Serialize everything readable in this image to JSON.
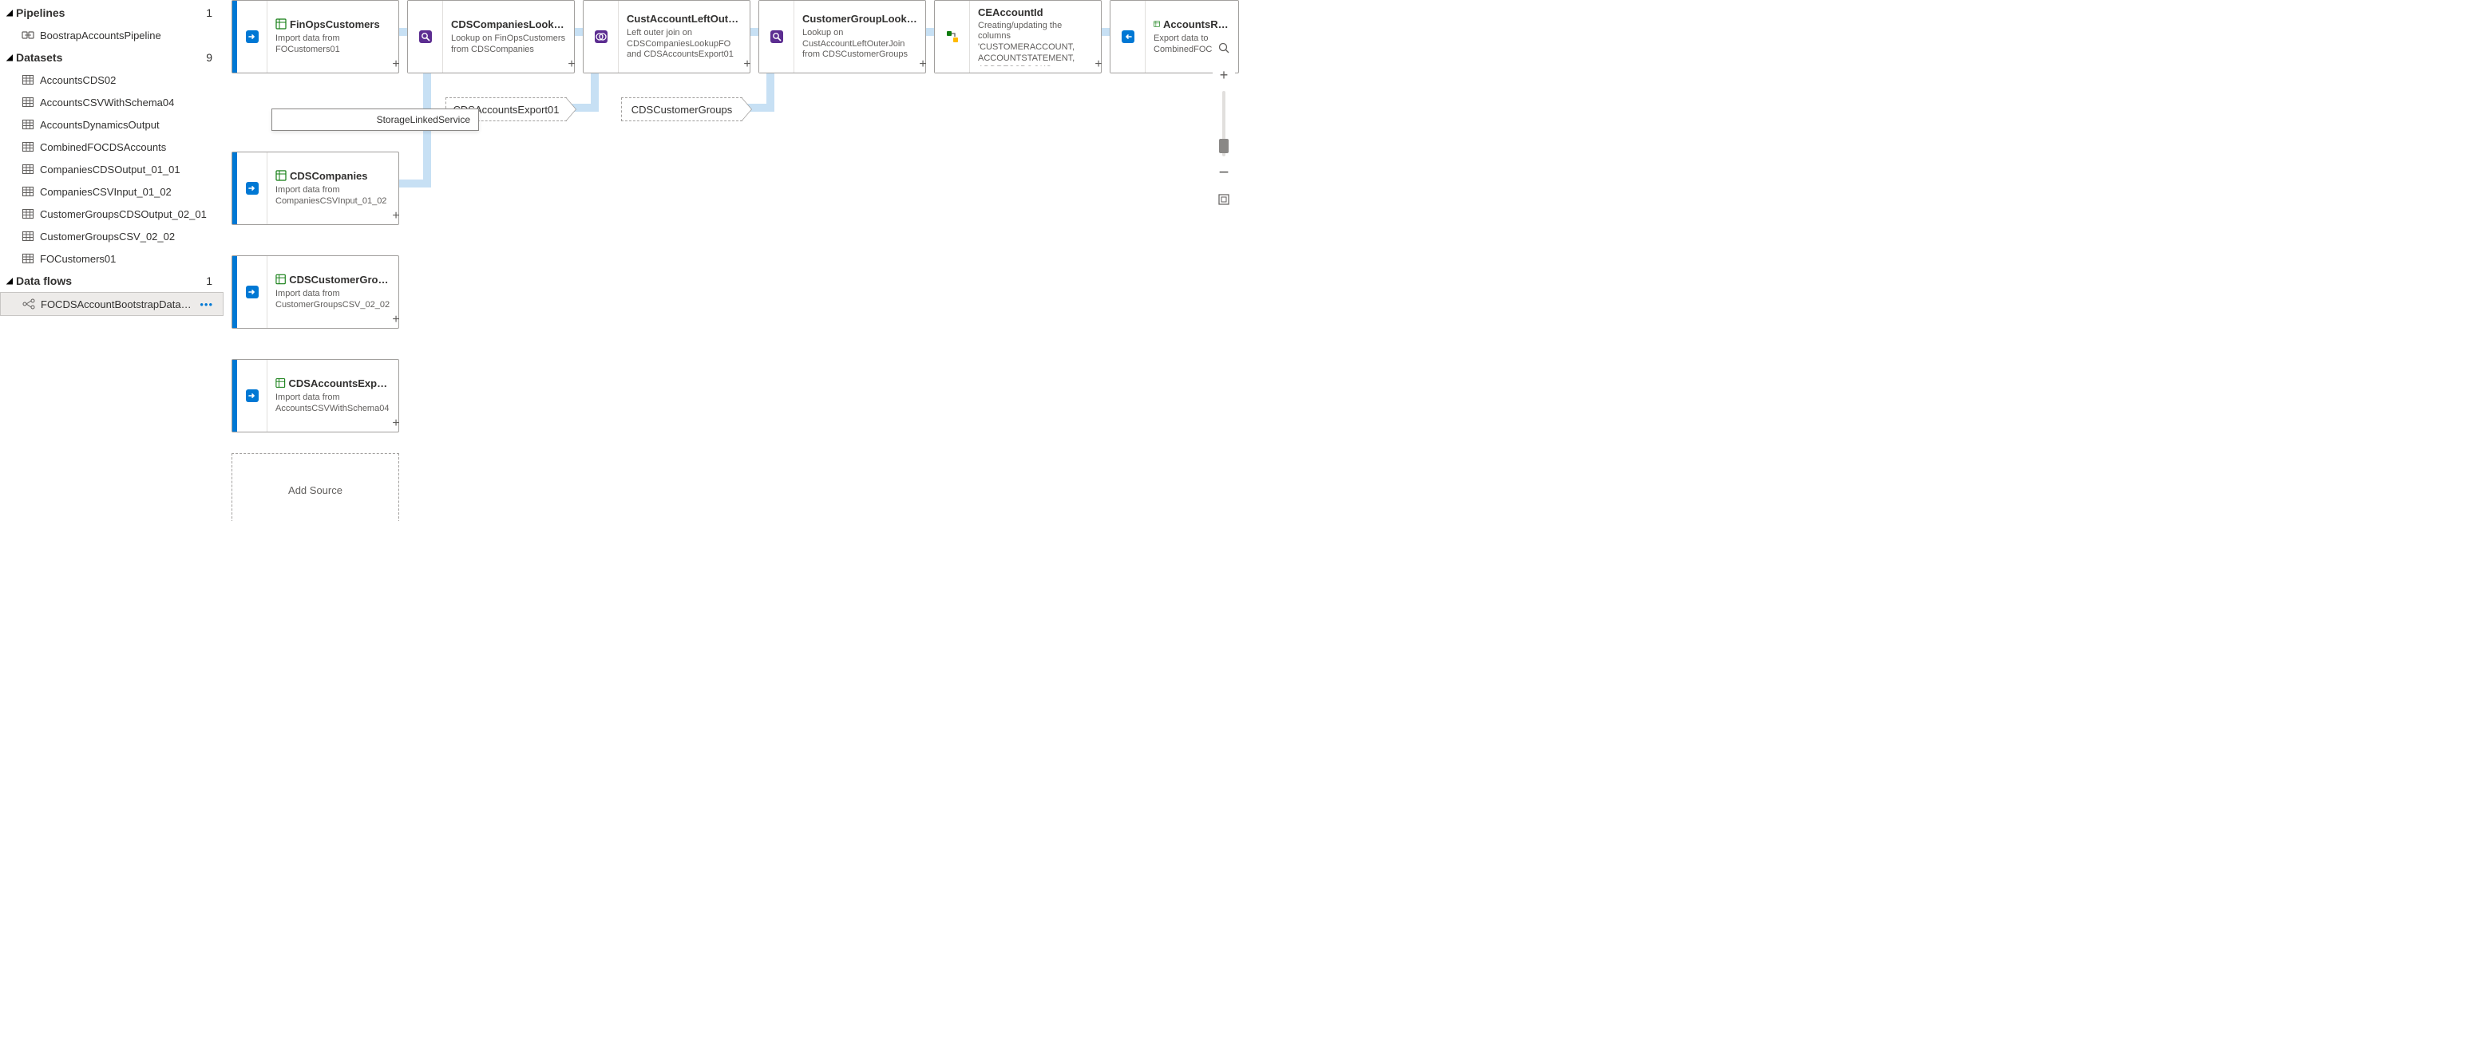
{
  "sidebar": {
    "sections": {
      "pipelines": {
        "label": "Pipelines",
        "count": "1"
      },
      "datasets": {
        "label": "Datasets",
        "count": "9"
      },
      "dataflows": {
        "label": "Data flows",
        "count": "1"
      }
    },
    "pipelines_items": [
      {
        "label": "BoostrapAccountsPipeline"
      }
    ],
    "datasets_items": [
      {
        "label": "AccountsCDS02"
      },
      {
        "label": "AccountsCSVWithSchema04"
      },
      {
        "label": "AccountsDynamicsOutput"
      },
      {
        "label": "CombinedFOCDSAccounts"
      },
      {
        "label": "CompaniesCDSOutput_01_01"
      },
      {
        "label": "CompaniesCSVInput_01_02"
      },
      {
        "label": "CustomerGroupsCDSOutput_02_01"
      },
      {
        "label": "CustomerGroupsCSV_02_02"
      },
      {
        "label": "FOCustomers01"
      }
    ],
    "dataflows_items": [
      {
        "label": "FOCDSAccountBootstrapDataF…"
      }
    ]
  },
  "canvas": {
    "tooltip": "StorageLinkedService",
    "add_source": "Add Source",
    "nodes": {
      "finops": {
        "title": "FinOpsCustomers",
        "desc": "Import data from FOCustomers01"
      },
      "cdscomp": {
        "title": "CDSCompanies",
        "desc": "Import data from CompaniesCSVInput_01_02"
      },
      "cdscg": {
        "title": "CDSCustomerGroups",
        "desc": "Import data from CustomerGroupsCSV_02_02"
      },
      "cdsacct": {
        "title": "CDSAccountsExport01",
        "desc": "Import data from AccountsCSVWithSchema04"
      },
      "lookupfo": {
        "title": "CDSCompaniesLookupFO",
        "desc": "Lookup on FinOpsCustomers from CDSCompanies"
      },
      "custleft": {
        "title": "CustAccountLeftOuterJ…",
        "desc": "Left outer join on CDSCompaniesLookupFO and CDSAccountsExport01"
      },
      "cglookup": {
        "title": "CustomerGroupLookup",
        "desc": "Lookup on CustAccountLeftOuterJoin from CDSCustomerGroups"
      },
      "ceacct": {
        "title": "CEAccountId",
        "desc": "Creating/updating the columns 'CUSTOMERACCOUNT, ACCOUNTSTATEMENT, ADDRESSBOOKS,"
      },
      "ready": {
        "title": "AccountsReadyForCDS",
        "desc": "Export data to CombinedFOCDSAccounts"
      },
      "ghost1": {
        "title": "CDSAccountsExport01"
      },
      "ghost2": {
        "title": "CDSCustomerGroups"
      }
    }
  }
}
